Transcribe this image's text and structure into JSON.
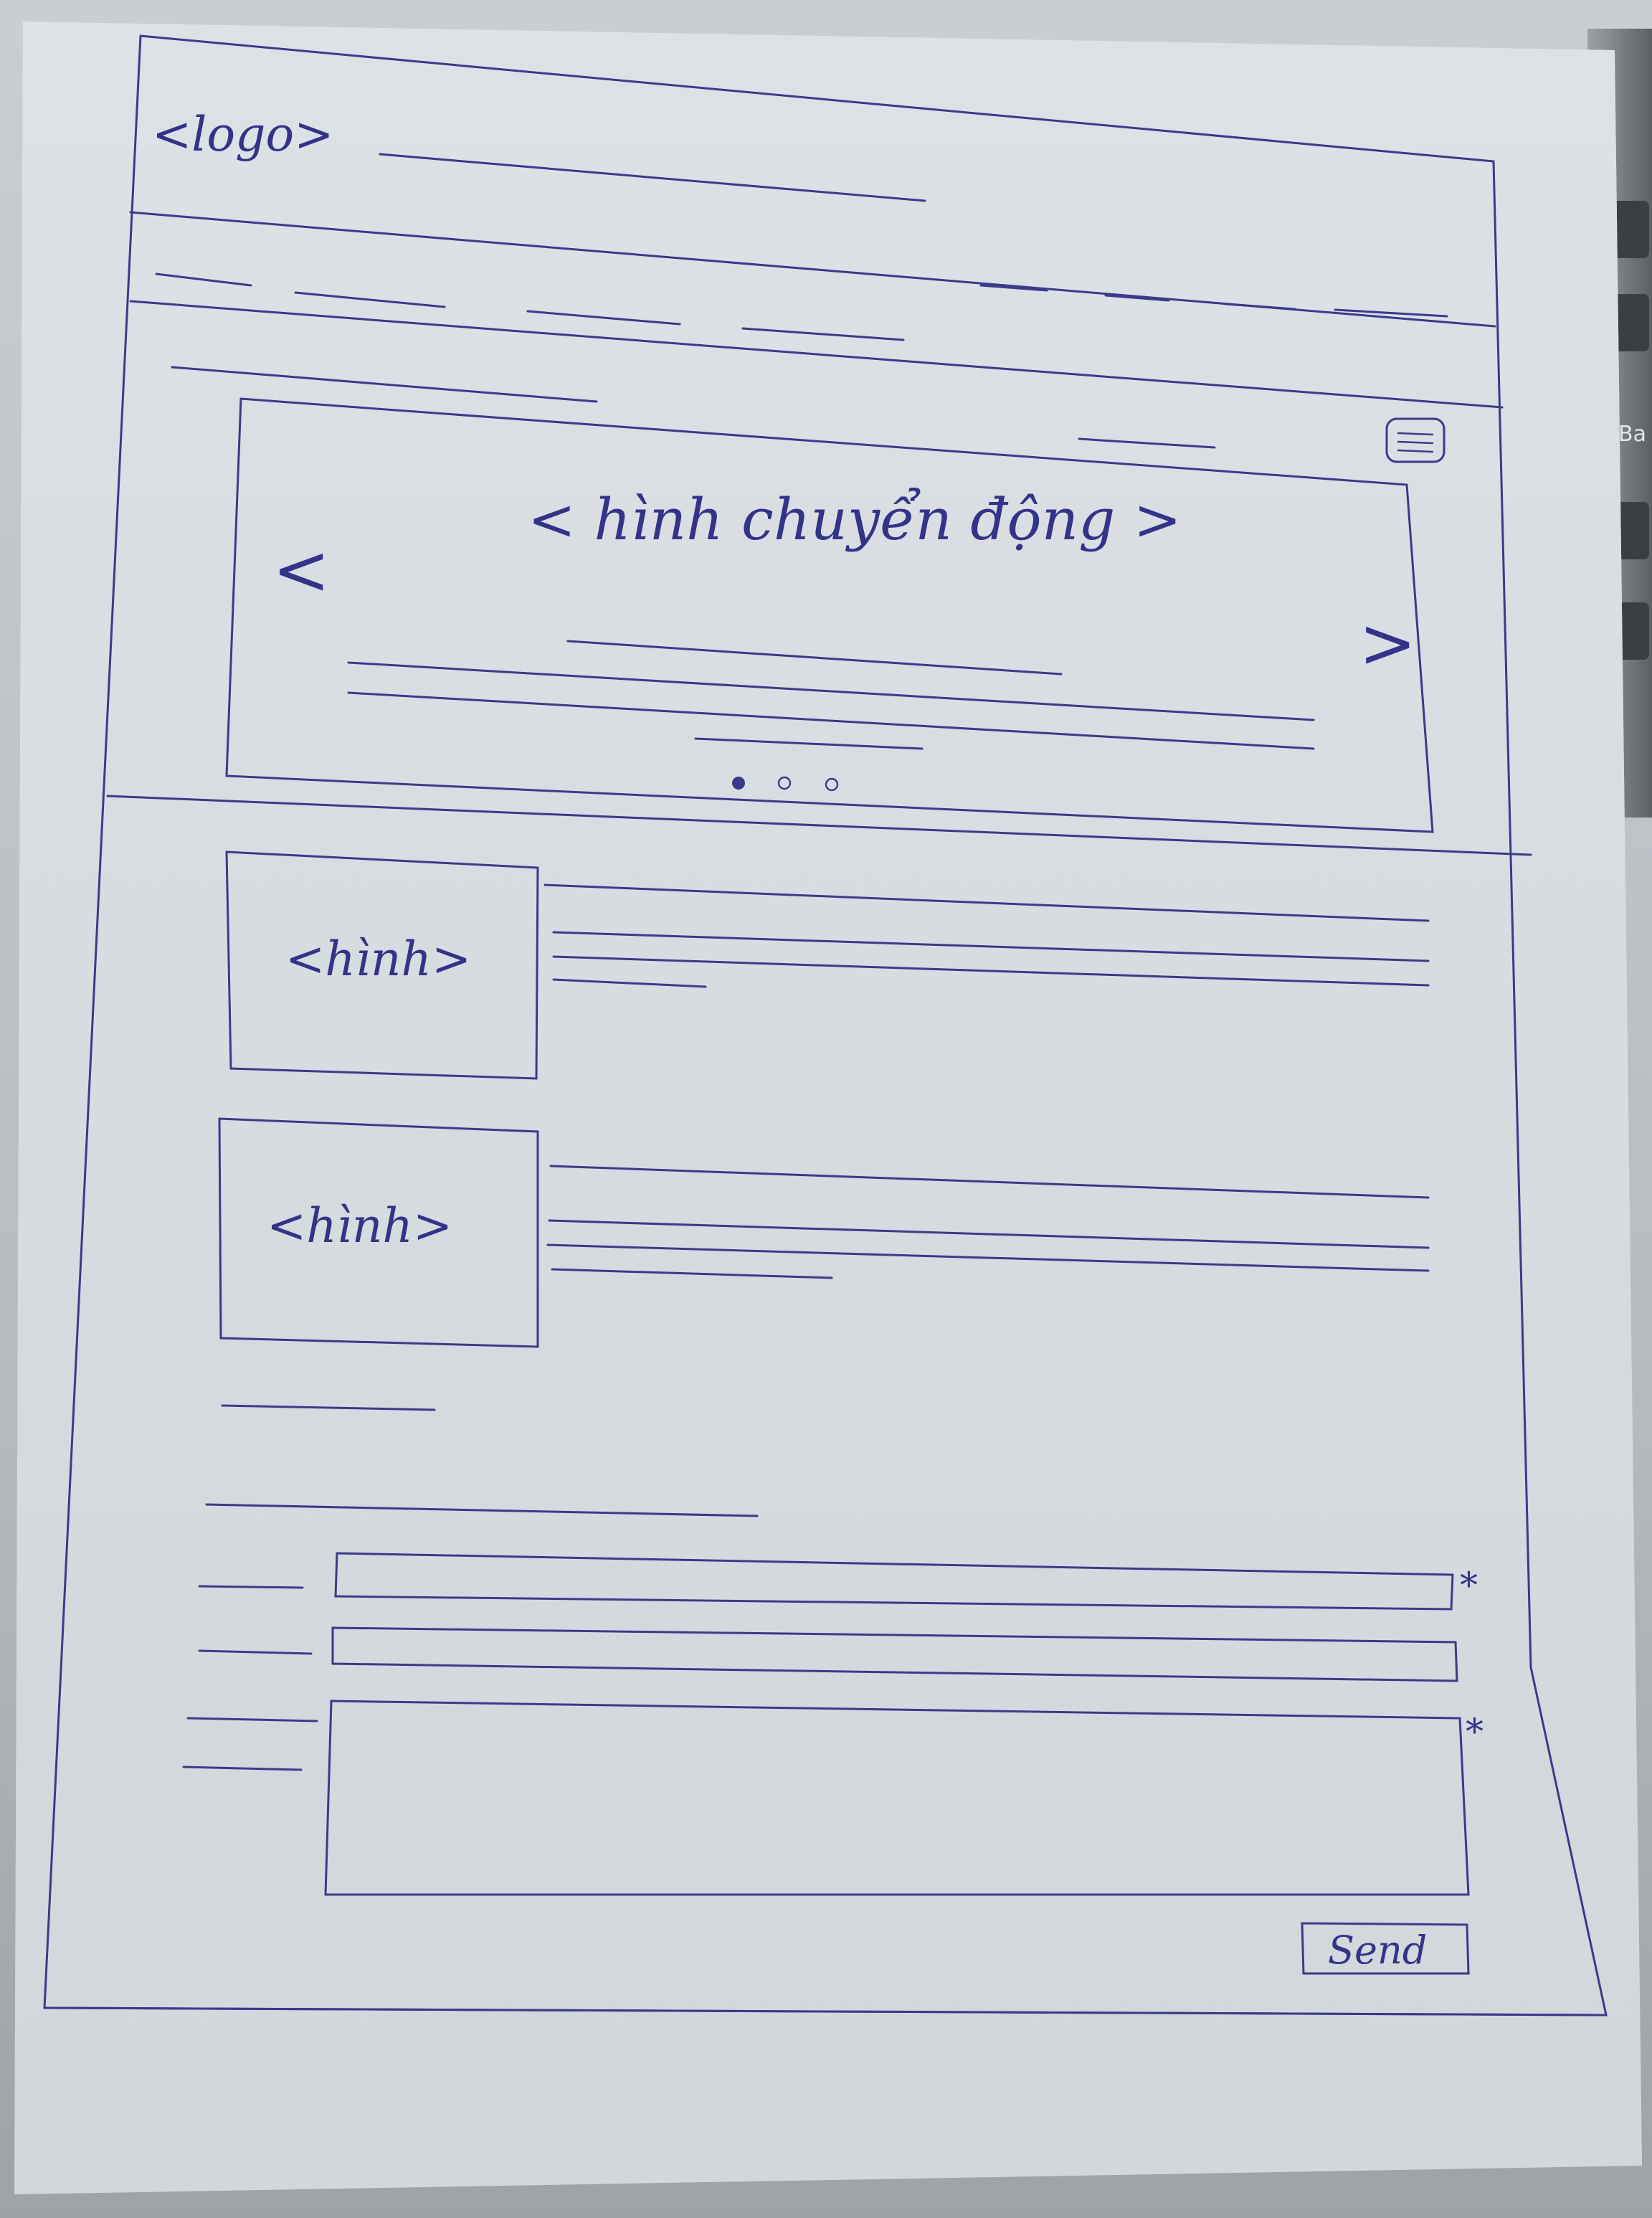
{
  "sketch": {
    "header": {
      "logo_label": "<logo>"
    },
    "slider": {
      "image_label": "< hình chuyển động >",
      "prev_arrow": "<",
      "next_arrow": ">",
      "dots": {
        "count": 3,
        "active_index": 0
      },
      "menu_icon": "hamburger-icon"
    },
    "articles": [
      {
        "image_label": "<hình>"
      },
      {
        "image_label": "<hình>"
      }
    ],
    "contact_form": {
      "required_marker": "*",
      "send_button": "Send"
    },
    "ink_color": "#3b3a8a"
  }
}
